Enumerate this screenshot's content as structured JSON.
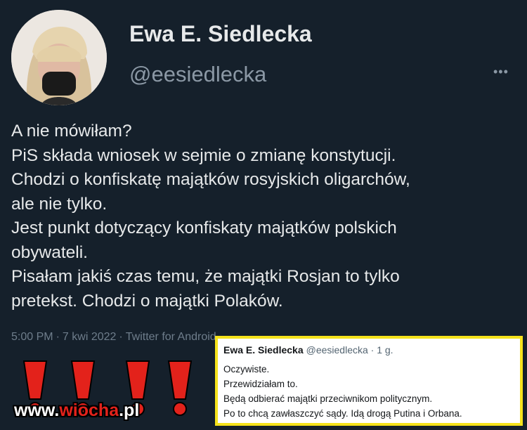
{
  "tweet": {
    "display_name": "Ewa E. Siedlecka",
    "handle": "@eesiedlecka",
    "more_icon": "more-icon",
    "lines": [
      "A nie mówiłam?",
      "PiS składa wniosek w sejmie o zmianę konstytucji.",
      "Chodzi o konfiskatę majątków rosyjskich oligarchów,",
      "ale nie tylko.",
      "Jest punkt dotyczący konfiskaty majątków polskich",
      "obywateli.",
      "Pisałam jakiś czas temu, że majątki Rosjan to tylko",
      "pretekst. Chodzi o majątki Polaków."
    ],
    "time": "5:00 PM",
    "date": "7 kwi 2022",
    "source": "Twitter for Android",
    "separator": "·"
  },
  "quote": {
    "name": "Ewa E. Siedlecka",
    "handle_time": "@eesiedlecka · 1 g.",
    "lines": [
      "Oczywiste.",
      "Przewidziałam to.",
      "Będą odbierać majątki przeciwnikom politycznym.",
      "Po to chcą zawłaszczyć sądy. Idą drogą Putina i Orbana."
    ],
    "border_color": "#f5e21b"
  },
  "watermark": {
    "prefix": "www.",
    "accent": "wiocha",
    "suffix": ".pl"
  },
  "colors": {
    "background": "#15202b",
    "text": "#e7e9ea",
    "muted": "#8b98a5",
    "exclamation": "#e3221b"
  }
}
